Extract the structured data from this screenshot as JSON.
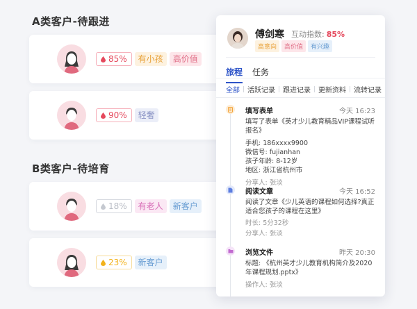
{
  "sections": [
    {
      "title": "A类客户-待跟进"
    },
    {
      "title": "B类客户-待培育"
    }
  ],
  "customers": [
    {
      "score": "85%",
      "score_color": "#e5495d",
      "tags": [
        "有小孩",
        "高价值"
      ]
    },
    {
      "score": "90%",
      "score_color": "#e5495d",
      "tags": [
        "轻奢"
      ]
    },
    {
      "score": "18%",
      "score_color": "#b8bcc4",
      "tags": [
        "有老人",
        "新客户"
      ]
    },
    {
      "score": "23%",
      "score_color": "#f2b21b",
      "tags": [
        "新客户"
      ]
    }
  ],
  "panel": {
    "name": "傅剑寒",
    "index_label": "互动指数:",
    "index_value": "85%",
    "tags": [
      "高意向",
      "高价值",
      "有兴趣"
    ],
    "tabs": [
      "旅程",
      "任务"
    ],
    "filters": [
      "全部",
      "活跃记录",
      "跟进记录",
      "更新资料",
      "流转记录"
    ],
    "events": [
      {
        "title": "填写表单",
        "time": "今天 16:23",
        "icon": "form-icon",
        "color": "#f3a43b",
        "lines": [
          "填写了表单《英才少儿教育精品VIP课程试听报名》",
          "手机: 186xxxx9900",
          "微信号: fujianhan",
          "孩子年龄: 8-12岁",
          "地区: 浙江省杭州市"
        ],
        "meta": "分享人: 张淡"
      },
      {
        "title": "阅读文章",
        "time": "今天 16:52",
        "icon": "document-icon",
        "color": "#5d7ee0",
        "lines": [
          "阅读了文章《少儿英语的课程如何选择?真正适合您孩子的课程在这里》",
          "时长: 5分32秒"
        ],
        "meta": "分享人: 张淡"
      },
      {
        "title": "浏览文件",
        "time": "昨天 20:30",
        "icon": "folder-icon",
        "color": "#c26bd0",
        "lines": [
          "标题: 《杭州英才少儿教育机构简介及2020年课程规划.pptx》"
        ],
        "meta": "操作人: 张淡"
      }
    ]
  }
}
